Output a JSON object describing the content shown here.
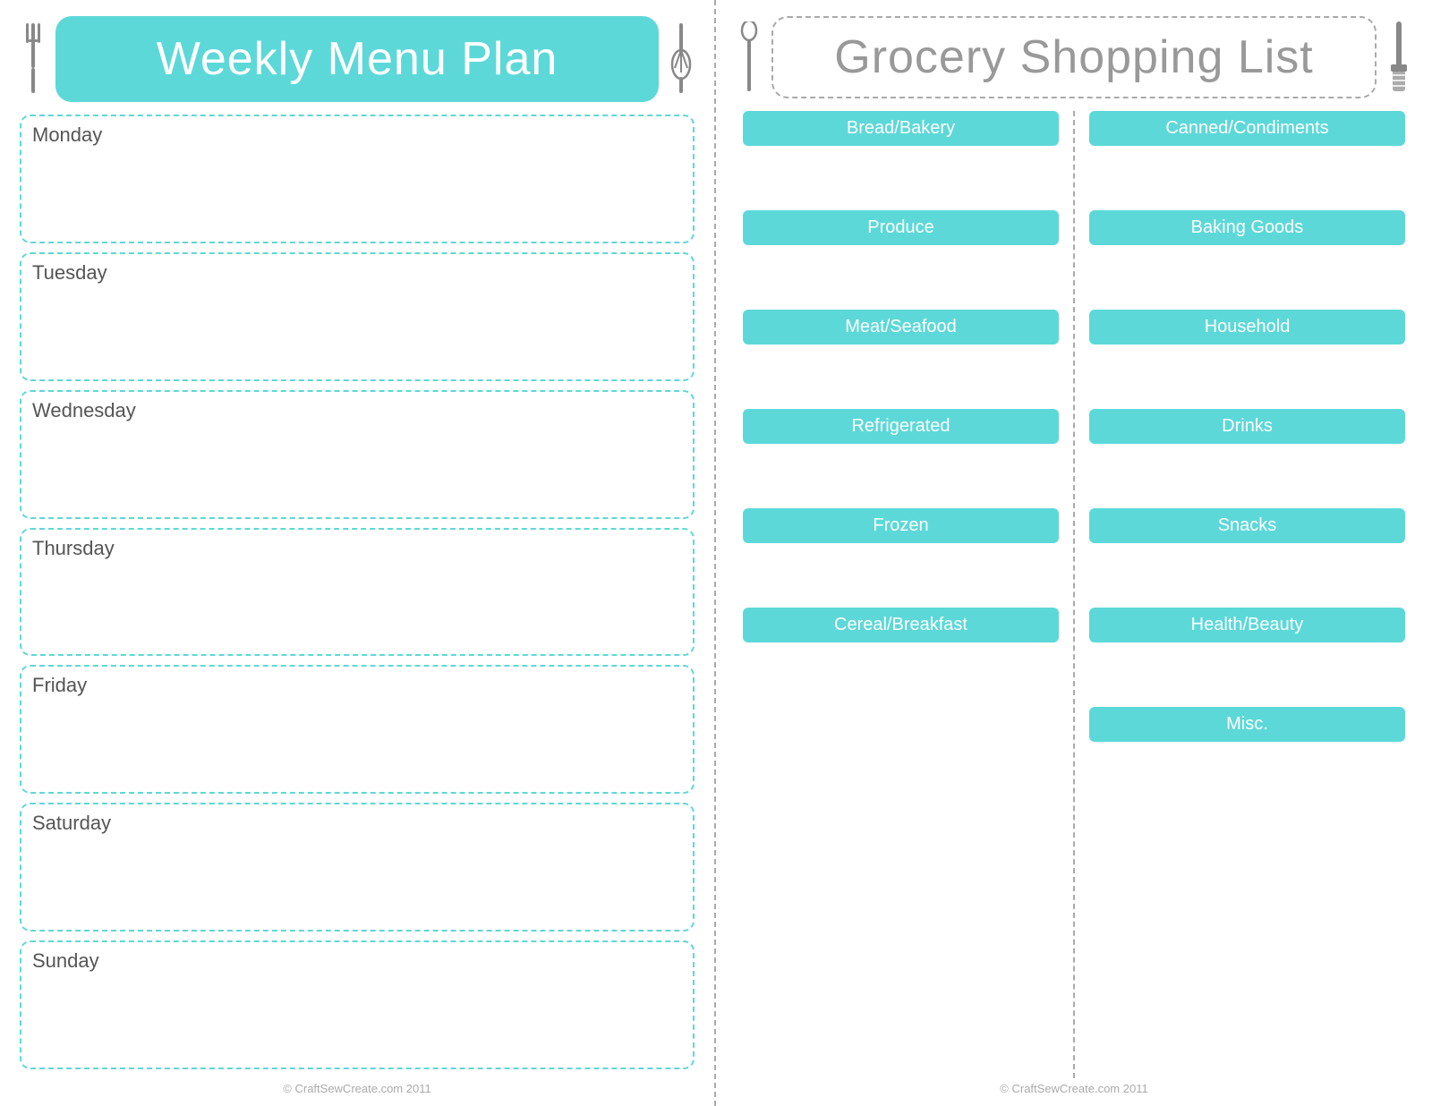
{
  "left": {
    "title": "Weekly Menu Plan",
    "days": [
      "Monday",
      "Tuesday",
      "Wednesday",
      "Thursday",
      "Friday",
      "Saturday",
      "Sunday"
    ],
    "copyright": "© CraftSewCreate.com 2011"
  },
  "right": {
    "title": "Grocery Shopping List",
    "col1_categories": [
      {
        "label": "Bread/Bakery",
        "space": "large"
      },
      {
        "label": "Produce",
        "space": "large"
      },
      {
        "label": "Meat/Seafood",
        "space": "large"
      },
      {
        "label": "Refrigerated",
        "space": "large"
      },
      {
        "label": "Frozen",
        "space": "large"
      },
      {
        "label": "Cereal/Breakfast",
        "space": "small"
      }
    ],
    "col2_categories": [
      {
        "label": "Canned/Condiments",
        "space": "xlarge"
      },
      {
        "label": "Baking Goods",
        "space": "large"
      },
      {
        "label": "Household",
        "space": "large"
      },
      {
        "label": "Drinks",
        "space": "large"
      },
      {
        "label": "Snacks",
        "space": "large"
      },
      {
        "label": "Health/Beauty",
        "space": "large"
      },
      {
        "label": "Misc.",
        "space": "small"
      }
    ],
    "copyright": "© CraftSewCreate.com 2011"
  },
  "icons": {
    "fork_color": "#888888",
    "whisk_color": "#888888",
    "spatula_color": "#888888",
    "spoon_color": "#888888"
  }
}
